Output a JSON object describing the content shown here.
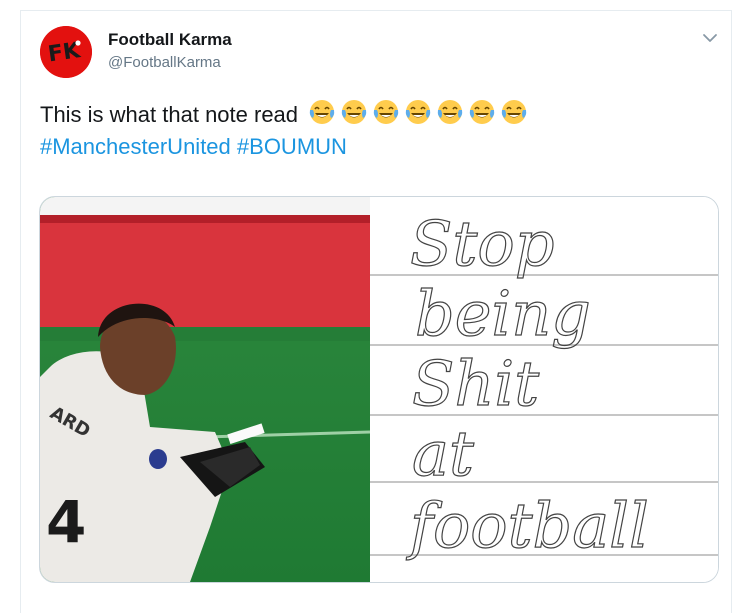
{
  "author": {
    "name": "Football Karma",
    "handle": "@FootballKarma",
    "avatar_text": "FK"
  },
  "tweet": {
    "text": "This is what that note read",
    "emoji_count": 7,
    "hashtags": [
      "#ManchesterUnited",
      "#BOUMUN"
    ]
  },
  "media": {
    "jersey_text": "ARD",
    "jersey_number": "4",
    "note_lines": [
      "Stop",
      "being",
      "Shit",
      "at",
      "football"
    ]
  },
  "colors": {
    "avatar_bg": "#e3110f",
    "hashtag": "#1b95e0",
    "name": "#14171a",
    "handle": "#657786",
    "border": "#ccd6dd"
  },
  "icons": {
    "menu": "chevron-down-icon",
    "emoji": "face-with-tears-of-joy-icon"
  }
}
